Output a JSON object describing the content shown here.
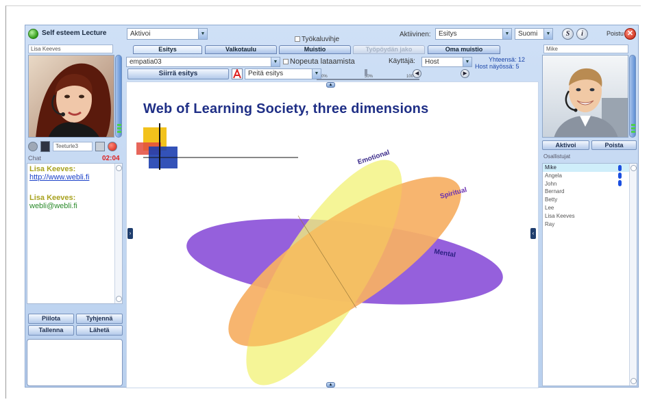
{
  "app": {
    "title": "Self esteem Lecture"
  },
  "top": {
    "status_combo": "Aktivoi",
    "tools_checkbox": "Työkaluvihje",
    "active_label": "Aktiivinen:",
    "active_value": "Esitys",
    "language": "Suomi",
    "exit_label": "Poistu"
  },
  "left": {
    "name": "Lisa Keeves",
    "status_field": "Teeturle3",
    "chat_title": "Chat",
    "chat_time": "02:04",
    "messages": [
      {
        "author": "Lisa Keeves:",
        "text": "http://www.webli.fi",
        "kind": "link"
      },
      {
        "author": "Lisa Keeves:",
        "text": "webli@webli.fi",
        "kind": "mail"
      }
    ],
    "buttons": {
      "hide": "Piilota",
      "clear": "Tyhjennä",
      "save": "Tallenna",
      "send": "Lähetä"
    }
  },
  "tabs": [
    {
      "label": "Esitys",
      "state": "active"
    },
    {
      "label": "Valkotaulu",
      "state": "normal"
    },
    {
      "label": "Muistio",
      "state": "normal"
    },
    {
      "label": "Työpöydän jako",
      "state": "disabled"
    },
    {
      "label": "Oma muistio",
      "state": "normal"
    }
  ],
  "toolbar": {
    "presentation": "empatia03",
    "no_upload_checkbox": "Nopeuta lataamista",
    "user_label": "Käyttäjä:",
    "user_value": "Host",
    "total": "Yhteensä: 12",
    "host_view": "Host näyössä: 5",
    "move_button": "Siirrä esitys",
    "hide_combo": "Peitä esitys",
    "slider_ticks": [
      "0%",
      "50%",
      "100%"
    ]
  },
  "slide": {
    "title": "Web of Learning Society, three dimensions",
    "labels": [
      "Emotional",
      "Spiritual",
      "Mental"
    ],
    "colors": {
      "emotional": "#f2f27a",
      "spiritual": "#f7a04a",
      "mental": "#8a4fd8",
      "title": "#1f2f86"
    }
  },
  "right": {
    "name": "Mike",
    "activate": "Aktivoi",
    "remove": "Poista",
    "participants_title": "Osallistujat",
    "participants": [
      "Mike",
      "Angela",
      "John",
      "Bernard",
      "Betty",
      "Lee",
      "Lisa Keeves",
      "Ray"
    ]
  },
  "icons": {
    "exit": "close-icon",
    "help": "info-icon",
    "skype": "skype-icon",
    "status": "online-status-icon"
  },
  "colors": {
    "accent": "#1f2f86",
    "chat_time": "#dd2222",
    "chat_author": "#a8a21f",
    "exit": "#c21e08",
    "status_online": "#2f9b18"
  }
}
